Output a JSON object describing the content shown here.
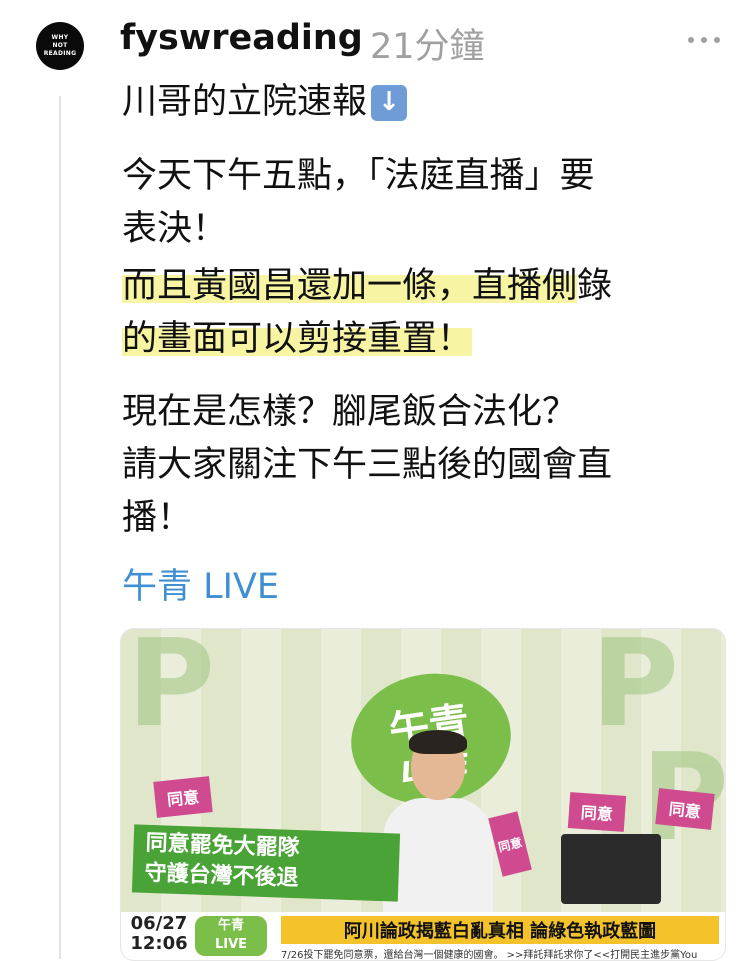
{
  "post": {
    "avatar_text": "WHY\nNOT\nREADING",
    "username": "fyswreading",
    "timestamp": "21分鐘",
    "title": "川哥的立院速報",
    "title_icon": "down-arrow-emoji",
    "para1": "今天下午五點，「法庭直播」要\n表決！",
    "hl1": "而且黃國昌還加一條，直播側",
    "tail1": "錄",
    "hl2": "的畫面可以剪接重置！",
    "para3": "現在是怎樣？腳尾飯合法化？\n請大家關注下午三點後的國會直\n播！",
    "link": "午青 LIVE"
  },
  "card": {
    "logo_main": "午青",
    "logo_sub": "LIVE",
    "flag_label": "同意",
    "banner_line1": "同意罷免大罷隊",
    "banner_line2": "守護台灣不後退",
    "date": "06/27",
    "time": "12:06",
    "live_logo": "午青\nLIVE",
    "headline": "阿川論政揭藍白亂真相 論綠色執政藍圖",
    "ticker": "7/26投下罷免同意票，還給台灣一個健康的國會。 >>拜託拜託求你了<<打開民主進步黨You"
  },
  "colors": {
    "username": "#111111",
    "timestamp": "#a0a0a0",
    "link": "#3f8fd2",
    "highlight": "#f7f5a3",
    "brand_green": "#7bbe4a",
    "flag_pink": "#cf4a8f",
    "headline_yellow": "#f4c22b"
  }
}
